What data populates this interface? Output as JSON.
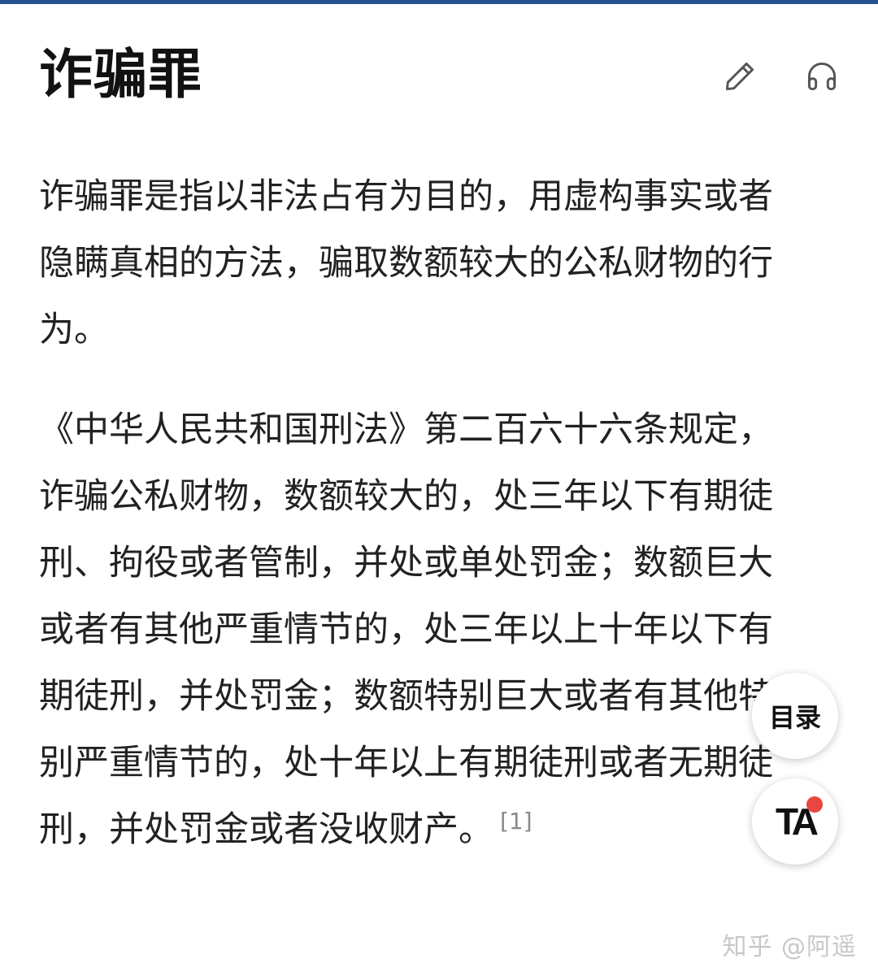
{
  "header": {
    "title": "诈骗罪",
    "edit_icon": "pencil-icon",
    "listen_icon": "headphones-icon"
  },
  "content": {
    "paragraph1": "诈骗罪是指以非法占有为目的，用虚构事实或者隐瞒真相的方法，骗取数额较大的公私财物的行为。",
    "paragraph2": "《中华人民共和国刑法》第二百六十六条规定，诈骗公私财物，数额较大的，处三年以下有期徒刑、拘役或者管制，并处或单处罚金；数额巨大或者有其他严重情节的，处三年以上十年以下有期徒刑，并处罚金；数额特别巨大或者有其他特别严重情节的，处十年以上有期徒刑或者无期徒刑，并处罚金或者没收财产。",
    "citation": "[1]"
  },
  "floating": {
    "toc_label": "目录",
    "ta_label": "TA"
  },
  "watermark": "知乎 @阿遥",
  "colors": {
    "top_bar": "#24508f",
    "badge_dot": "#e8473f",
    "watermark": "#c8c8c8"
  }
}
